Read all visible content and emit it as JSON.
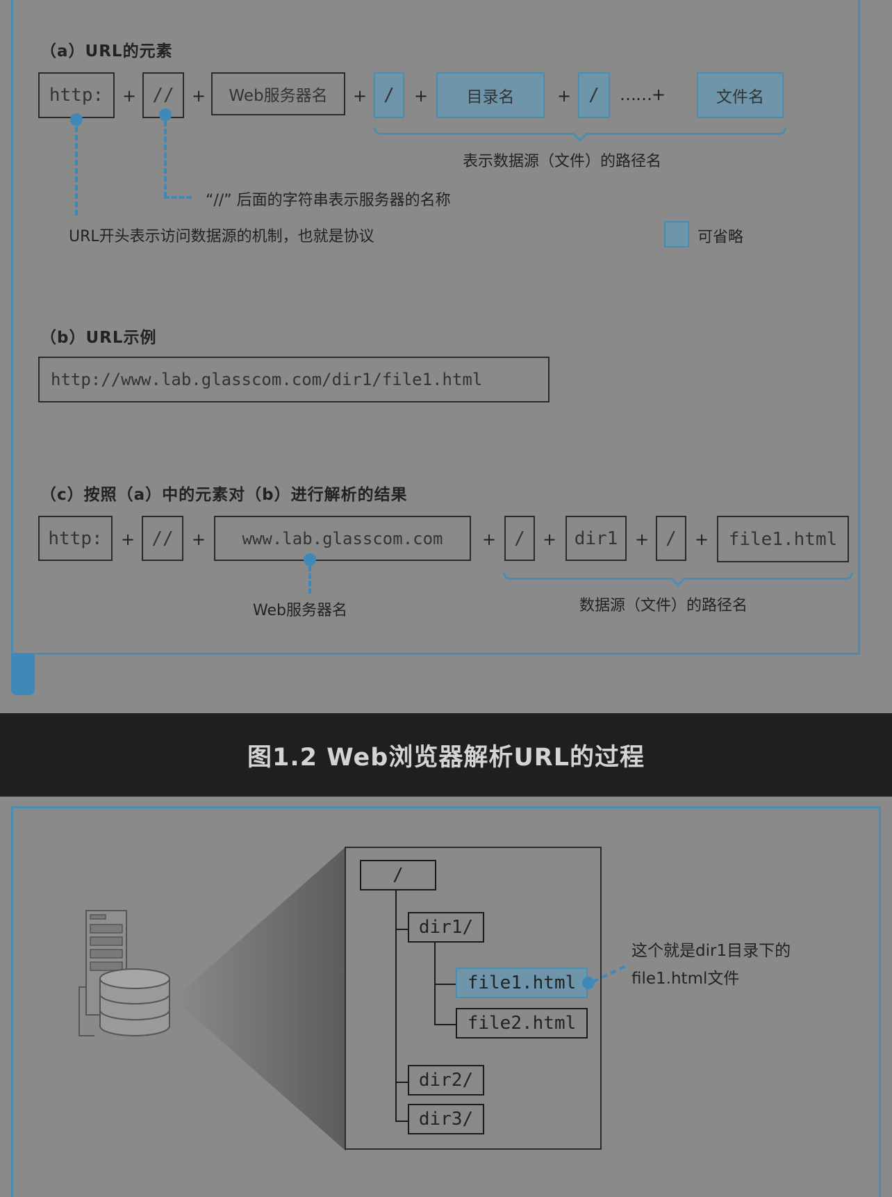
{
  "part_a": {
    "title": "（a）URL的元素",
    "boxes": [
      "http:",
      "//",
      "Web服务器名",
      "/",
      "目录名",
      "/",
      "文件名"
    ],
    "plus": "+",
    "ellipsis_plus": "……+",
    "path_label": "表示数据源（文件）的路径名",
    "slash_note": "“//” 后面的字符串表示服务器的名称",
    "protocol_note": "URL开头表示访问数据源的机制，也就是协议",
    "legend_label": "可省略"
  },
  "part_b": {
    "title": "（b）URL示例",
    "url": "http://www.lab.glasscom.com/dir1/file1.html"
  },
  "part_c": {
    "title": "（c）按照（a）中的元素对（b）进行解析的结果",
    "boxes": [
      "http:",
      "//",
      "www.lab.glasscom.com",
      "/",
      "dir1",
      "/",
      "file1.html"
    ],
    "server_label": "Web服务器名",
    "path_label": "数据源（文件）的路径名"
  },
  "caption": "图1.2 Web浏览器解析URL的过程",
  "tree": {
    "root": "/",
    "dir1": "dir1/",
    "file1": "file1.html",
    "file2": "file2.html",
    "dir2": "dir2/",
    "dir3": "dir3/",
    "note_line1": "这个就是dir1目录下的",
    "note_line2": "file1.html文件"
  },
  "colors": {
    "accent": "#4a8db0",
    "highlight_fill": "#6f95ab",
    "background": "#8a8a8a",
    "caption_band": "#1f1f21"
  }
}
